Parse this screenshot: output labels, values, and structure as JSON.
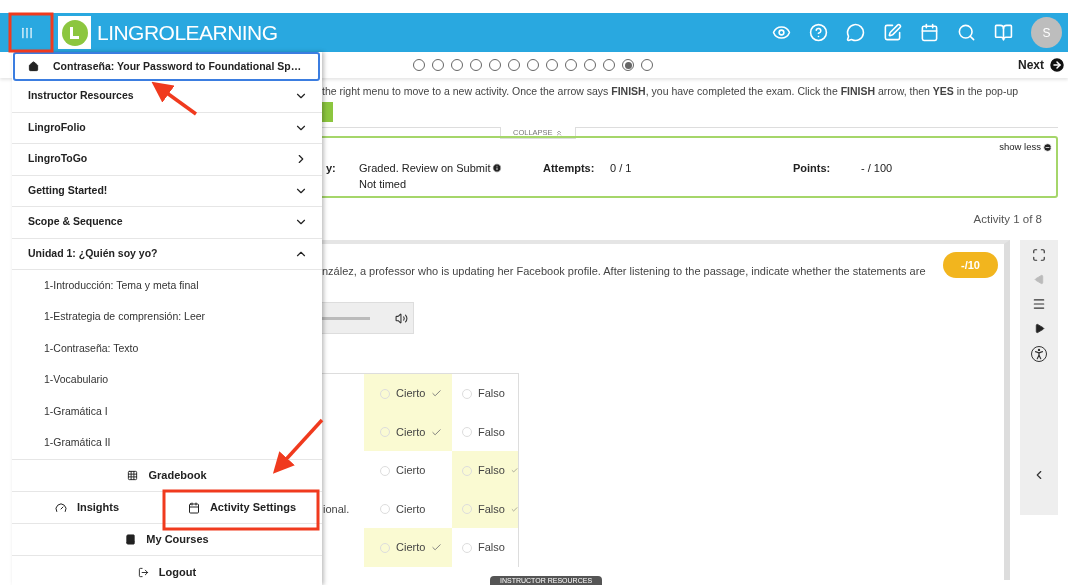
{
  "header": {
    "logo_bold": "LINGRO",
    "logo_light": "LEARNING",
    "avatar": "S"
  },
  "progress": {
    "dots": [
      {
        "selected": false
      },
      {
        "selected": false
      },
      {
        "selected": false
      },
      {
        "selected": false
      },
      {
        "selected": false
      },
      {
        "selected": false
      },
      {
        "selected": false
      },
      {
        "selected": false
      },
      {
        "selected": false
      },
      {
        "selected": false
      },
      {
        "selected": false
      },
      {
        "selected": true
      },
      {
        "selected": false
      }
    ],
    "next": "Next"
  },
  "instructions": "the right menu to move to a new activity. Once the arrow says **FINISH**, you have completed the exam. Click the **FINISH** arrow, then **YES** in the pop-up",
  "collapse": "COLLAPSE",
  "info": {
    "show_less": "show less",
    "label_1": "y:",
    "value_1": "Graded. Review on Submit",
    "value_1b": "Not timed",
    "attempts_label": "Attempts:",
    "attempts": "0 / 1",
    "points_label": "Points:",
    "points": "- / 100"
  },
  "activity_counter": "Activity 1 of 8",
  "question": {
    "prompt": "nzález, a professor who is updating her Facebook profile. After listening to the passage, indicate whether the statements are",
    "score": "-/10",
    "rows": [
      {
        "options": [
          {
            "label": "Cierto",
            "correct": true
          },
          {
            "label": "Falso",
            "correct": false
          }
        ]
      },
      {
        "options": [
          {
            "label": "Cierto",
            "correct": true
          },
          {
            "label": "Falso",
            "correct": false
          }
        ]
      },
      {
        "options": [
          {
            "label": "Cierto",
            "correct": false
          },
          {
            "label": "Falso",
            "correct": true
          }
        ]
      },
      {
        "statement": "ional.",
        "options": [
          {
            "label": "Cierto",
            "correct": false
          },
          {
            "label": "Falso",
            "correct": true
          }
        ]
      },
      {
        "options": [
          {
            "label": "Cierto",
            "correct": true
          },
          {
            "label": "Falso",
            "correct": false
          }
        ]
      }
    ]
  },
  "bottom_tab": "INSTRUCTOR RESOURCES",
  "menu": {
    "course_title": "Contraseña: Your Password to Foundational Sp…",
    "sections": [
      {
        "label": "Instructor Resources",
        "kind": "accordion",
        "expanded": false
      },
      {
        "label": "LingroFolio",
        "kind": "accordion",
        "expanded": false
      },
      {
        "label": "LingroToGo",
        "kind": "link"
      },
      {
        "label": "Getting Started!",
        "kind": "accordion",
        "expanded": false
      },
      {
        "label": "Scope & Sequence",
        "kind": "accordion",
        "expanded": false
      },
      {
        "label": "Unidad 1: ¿Quién soy yo?",
        "kind": "accordion",
        "expanded": true,
        "children": [
          {
            "label": "1-Introducción: Tema y meta final"
          },
          {
            "label": "1-Estrategia de comprensión: Leer"
          },
          {
            "label": "1-Contraseña: Texto"
          },
          {
            "label": "1-Vocabulario"
          },
          {
            "label": "1-Gramática I"
          },
          {
            "label": "1-Gramática II"
          }
        ]
      }
    ],
    "gradebook": "Gradebook",
    "insights": "Insights",
    "activity_settings": "Activity Settings",
    "my_courses": "My Courses",
    "logout": "Logout"
  }
}
